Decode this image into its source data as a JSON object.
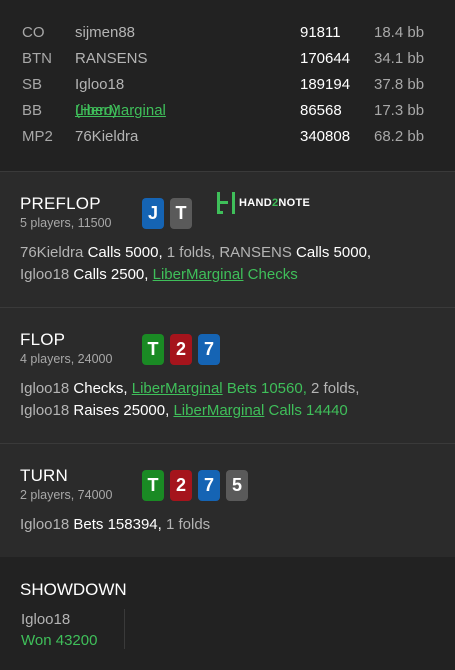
{
  "players": [
    {
      "position": "CO",
      "name": "sijmen88",
      "stack": "91811",
      "bb": "18.4 bb"
    },
    {
      "position": "BTN",
      "name": "RANSENS",
      "stack": "170644",
      "bb": "34.1 bb"
    },
    {
      "position": "SB",
      "name": "Igloo18",
      "stack": "189194",
      "bb": "37.8 bb"
    },
    {
      "position": "BB",
      "name": "LiberMarginal",
      "hero_tag": "(Hero)",
      "stack": "86568",
      "bb": "17.3 bb"
    },
    {
      "position": "MP2",
      "name": "76Kieldra",
      "stack": "340808",
      "bb": "68.2 bb"
    }
  ],
  "logo": {
    "prefix": "HAND",
    "two": "2",
    "suffix": "NOTE"
  },
  "preflop": {
    "title": "PREFLOP",
    "subtitle": "5 players, 11500",
    "cards": [
      {
        "rank": "J",
        "suit": "d"
      },
      {
        "rank": "T",
        "suit": "s"
      }
    ],
    "line1": {
      "p1": "76Kieldra",
      "a1": "Calls 5000,",
      "m1": "1 folds,",
      "p2": "RANSENS",
      "a2": "Calls 5000,"
    },
    "line2": {
      "p1": "Igloo18",
      "a1": "Calls 2500,",
      "hero": "LiberMarginal",
      "ha": "Checks"
    }
  },
  "flop": {
    "title": "FLOP",
    "subtitle": "4 players, 24000",
    "cards": [
      {
        "rank": "T",
        "suit": "c"
      },
      {
        "rank": "2",
        "suit": "h"
      },
      {
        "rank": "7",
        "suit": "d"
      }
    ],
    "line1": {
      "p1": "Igloo18",
      "a1": "Checks,",
      "hero": "LiberMarginal",
      "ha": "Bets 10560,",
      "m1": "2 folds,"
    },
    "line2": {
      "p1": "Igloo18",
      "a1": "Raises 25000,",
      "hero": "LiberMarginal",
      "ha": "Calls 14440"
    }
  },
  "turn": {
    "title": "TURN",
    "subtitle": "2 players, 74000",
    "cards": [
      {
        "rank": "T",
        "suit": "c"
      },
      {
        "rank": "2",
        "suit": "h"
      },
      {
        "rank": "7",
        "suit": "d"
      },
      {
        "rank": "5",
        "suit": "s"
      }
    ],
    "line1": {
      "p1": "Igloo18",
      "a1": "Bets 158394,",
      "m1": "1 folds"
    }
  },
  "showdown": {
    "title": "SHOWDOWN",
    "player": "Igloo18",
    "result": "Won 43200"
  },
  "colors": {
    "hero": "#3fbf5a",
    "clubs": "#1a8a24",
    "hearts": "#a5141c",
    "diamonds": "#1564b4",
    "spades": "#5a5a5a"
  }
}
